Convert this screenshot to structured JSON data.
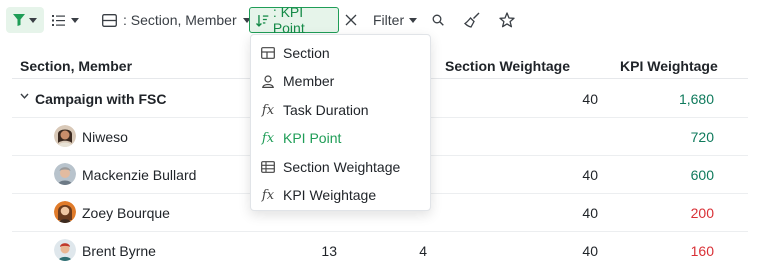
{
  "toolbar": {
    "group_label": ": Section, Member",
    "sort_label": ": KPI Point",
    "filter_label": "Filter"
  },
  "table": {
    "headers": {
      "section_member": "Section, Member",
      "section_weightage": "Section Weightage",
      "kpi_weightage": "KPI Weightage"
    },
    "group": {
      "name": "Campaign with FSC",
      "section_weightage": "40",
      "kpi_weightage": "1,680"
    },
    "rows": [
      {
        "name": "Niweso",
        "task_duration": "",
        "kpi_point": "",
        "section_weightage": "",
        "kpi_weightage": "720"
      },
      {
        "name": "Mackenzie Bullard",
        "task_duration": "",
        "kpi_point": "",
        "section_weightage": "40",
        "kpi_weightage": "600"
      },
      {
        "name": "Zoey Bourque",
        "task_duration": "",
        "kpi_point": "",
        "section_weightage": "40",
        "kpi_weightage": "200"
      },
      {
        "name": "Brent Byrne",
        "task_duration": "13",
        "kpi_point": "4",
        "section_weightage": "40",
        "kpi_weightage": "160"
      }
    ]
  },
  "dropdown": {
    "items": [
      {
        "label": "Section",
        "icon": "section-icon"
      },
      {
        "label": "Member",
        "icon": "user-icon"
      },
      {
        "label": "Task Duration",
        "icon": "formula-icon"
      },
      {
        "label": "KPI Point",
        "icon": "formula-icon"
      },
      {
        "label": "Section Weightage",
        "icon": "table-icon"
      },
      {
        "label": "KPI Weightage",
        "icon": "formula-icon"
      }
    ]
  },
  "colors": {
    "accent": "#1f9d57",
    "positive": "#0f7a5c",
    "negative": "#d93036"
  }
}
